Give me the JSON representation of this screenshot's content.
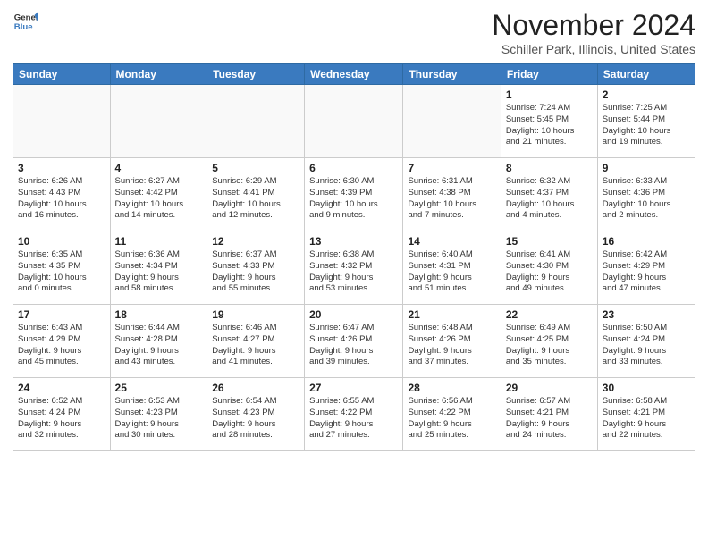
{
  "header": {
    "logo_general": "General",
    "logo_blue": "Blue",
    "month": "November 2024",
    "location": "Schiller Park, Illinois, United States"
  },
  "weekdays": [
    "Sunday",
    "Monday",
    "Tuesday",
    "Wednesday",
    "Thursday",
    "Friday",
    "Saturday"
  ],
  "weeks": [
    [
      {
        "day": "",
        "info": ""
      },
      {
        "day": "",
        "info": ""
      },
      {
        "day": "",
        "info": ""
      },
      {
        "day": "",
        "info": ""
      },
      {
        "day": "",
        "info": ""
      },
      {
        "day": "1",
        "info": "Sunrise: 7:24 AM\nSunset: 5:45 PM\nDaylight: 10 hours\nand 21 minutes."
      },
      {
        "day": "2",
        "info": "Sunrise: 7:25 AM\nSunset: 5:44 PM\nDaylight: 10 hours\nand 19 minutes."
      }
    ],
    [
      {
        "day": "3",
        "info": "Sunrise: 6:26 AM\nSunset: 4:43 PM\nDaylight: 10 hours\nand 16 minutes."
      },
      {
        "day": "4",
        "info": "Sunrise: 6:27 AM\nSunset: 4:42 PM\nDaylight: 10 hours\nand 14 minutes."
      },
      {
        "day": "5",
        "info": "Sunrise: 6:29 AM\nSunset: 4:41 PM\nDaylight: 10 hours\nand 12 minutes."
      },
      {
        "day": "6",
        "info": "Sunrise: 6:30 AM\nSunset: 4:39 PM\nDaylight: 10 hours\nand 9 minutes."
      },
      {
        "day": "7",
        "info": "Sunrise: 6:31 AM\nSunset: 4:38 PM\nDaylight: 10 hours\nand 7 minutes."
      },
      {
        "day": "8",
        "info": "Sunrise: 6:32 AM\nSunset: 4:37 PM\nDaylight: 10 hours\nand 4 minutes."
      },
      {
        "day": "9",
        "info": "Sunrise: 6:33 AM\nSunset: 4:36 PM\nDaylight: 10 hours\nand 2 minutes."
      }
    ],
    [
      {
        "day": "10",
        "info": "Sunrise: 6:35 AM\nSunset: 4:35 PM\nDaylight: 10 hours\nand 0 minutes."
      },
      {
        "day": "11",
        "info": "Sunrise: 6:36 AM\nSunset: 4:34 PM\nDaylight: 9 hours\nand 58 minutes."
      },
      {
        "day": "12",
        "info": "Sunrise: 6:37 AM\nSunset: 4:33 PM\nDaylight: 9 hours\nand 55 minutes."
      },
      {
        "day": "13",
        "info": "Sunrise: 6:38 AM\nSunset: 4:32 PM\nDaylight: 9 hours\nand 53 minutes."
      },
      {
        "day": "14",
        "info": "Sunrise: 6:40 AM\nSunset: 4:31 PM\nDaylight: 9 hours\nand 51 minutes."
      },
      {
        "day": "15",
        "info": "Sunrise: 6:41 AM\nSunset: 4:30 PM\nDaylight: 9 hours\nand 49 minutes."
      },
      {
        "day": "16",
        "info": "Sunrise: 6:42 AM\nSunset: 4:29 PM\nDaylight: 9 hours\nand 47 minutes."
      }
    ],
    [
      {
        "day": "17",
        "info": "Sunrise: 6:43 AM\nSunset: 4:29 PM\nDaylight: 9 hours\nand 45 minutes."
      },
      {
        "day": "18",
        "info": "Sunrise: 6:44 AM\nSunset: 4:28 PM\nDaylight: 9 hours\nand 43 minutes."
      },
      {
        "day": "19",
        "info": "Sunrise: 6:46 AM\nSunset: 4:27 PM\nDaylight: 9 hours\nand 41 minutes."
      },
      {
        "day": "20",
        "info": "Sunrise: 6:47 AM\nSunset: 4:26 PM\nDaylight: 9 hours\nand 39 minutes."
      },
      {
        "day": "21",
        "info": "Sunrise: 6:48 AM\nSunset: 4:26 PM\nDaylight: 9 hours\nand 37 minutes."
      },
      {
        "day": "22",
        "info": "Sunrise: 6:49 AM\nSunset: 4:25 PM\nDaylight: 9 hours\nand 35 minutes."
      },
      {
        "day": "23",
        "info": "Sunrise: 6:50 AM\nSunset: 4:24 PM\nDaylight: 9 hours\nand 33 minutes."
      }
    ],
    [
      {
        "day": "24",
        "info": "Sunrise: 6:52 AM\nSunset: 4:24 PM\nDaylight: 9 hours\nand 32 minutes."
      },
      {
        "day": "25",
        "info": "Sunrise: 6:53 AM\nSunset: 4:23 PM\nDaylight: 9 hours\nand 30 minutes."
      },
      {
        "day": "26",
        "info": "Sunrise: 6:54 AM\nSunset: 4:23 PM\nDaylight: 9 hours\nand 28 minutes."
      },
      {
        "day": "27",
        "info": "Sunrise: 6:55 AM\nSunset: 4:22 PM\nDaylight: 9 hours\nand 27 minutes."
      },
      {
        "day": "28",
        "info": "Sunrise: 6:56 AM\nSunset: 4:22 PM\nDaylight: 9 hours\nand 25 minutes."
      },
      {
        "day": "29",
        "info": "Sunrise: 6:57 AM\nSunset: 4:21 PM\nDaylight: 9 hours\nand 24 minutes."
      },
      {
        "day": "30",
        "info": "Sunrise: 6:58 AM\nSunset: 4:21 PM\nDaylight: 9 hours\nand 22 minutes."
      }
    ]
  ]
}
